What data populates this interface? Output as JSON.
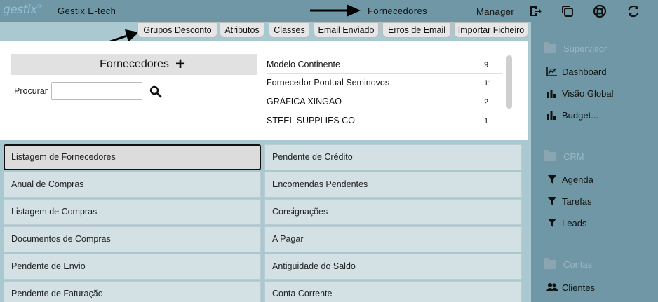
{
  "header": {
    "logo": "gestix",
    "logo_mark": "®",
    "company": "Gestix E-tech",
    "page_title": "Fornecedores",
    "user": "Manager",
    "icons": [
      "logout-icon",
      "windows-icon",
      "help-lifebuoy-icon",
      "refresh-icon"
    ]
  },
  "tabs": [
    {
      "label": "Grupos Desconto"
    },
    {
      "label": "Atributos"
    },
    {
      "label": "Classes"
    },
    {
      "label": "Email Enviado"
    },
    {
      "label": "Erros de Email"
    },
    {
      "label": "Importar Ficheiro"
    }
  ],
  "suppliers": {
    "title": "Fornecedores",
    "add_symbol": "+",
    "search_label": "Procurar",
    "search_value": "",
    "search_placeholder": ""
  },
  "recent": [
    {
      "name": "Modelo Continente",
      "count": "9"
    },
    {
      "name": "Fornecedor Pontual Seminovos",
      "count": "11"
    },
    {
      "name": "GRÁFICA XINGAO",
      "count": "2"
    },
    {
      "name": "STEEL SUPPLIES CO",
      "count": "1"
    }
  ],
  "grid": {
    "left": [
      "Listagem de Fornecedores",
      "Anual de Compras",
      "Listagem de Compras",
      "Documentos de Compras",
      "Pendente de Envio",
      "Pendente de Faturação"
    ],
    "right": [
      "Pendente de Crédito",
      "Encomendas Pendentes",
      "Consignações",
      "A Pagar",
      "Antiguidade do Saldo",
      "Conta Corrente"
    ]
  },
  "sidebar": {
    "supervisor": {
      "title": "Supervisor",
      "items": [
        "Dashboard",
        "Visão Global",
        "Budget..."
      ]
    },
    "crm": {
      "title": "CRM",
      "items": [
        "Agenda",
        "Tarefas",
        "Leads"
      ]
    },
    "contas": {
      "title": "Contas",
      "items": [
        "Clientes"
      ]
    }
  },
  "colors": {
    "header_bg": "#6f97a5",
    "content_bg": "#a9c8d0",
    "grid_button_bg": "#d3e0e4",
    "logo": "#8fc3db"
  }
}
